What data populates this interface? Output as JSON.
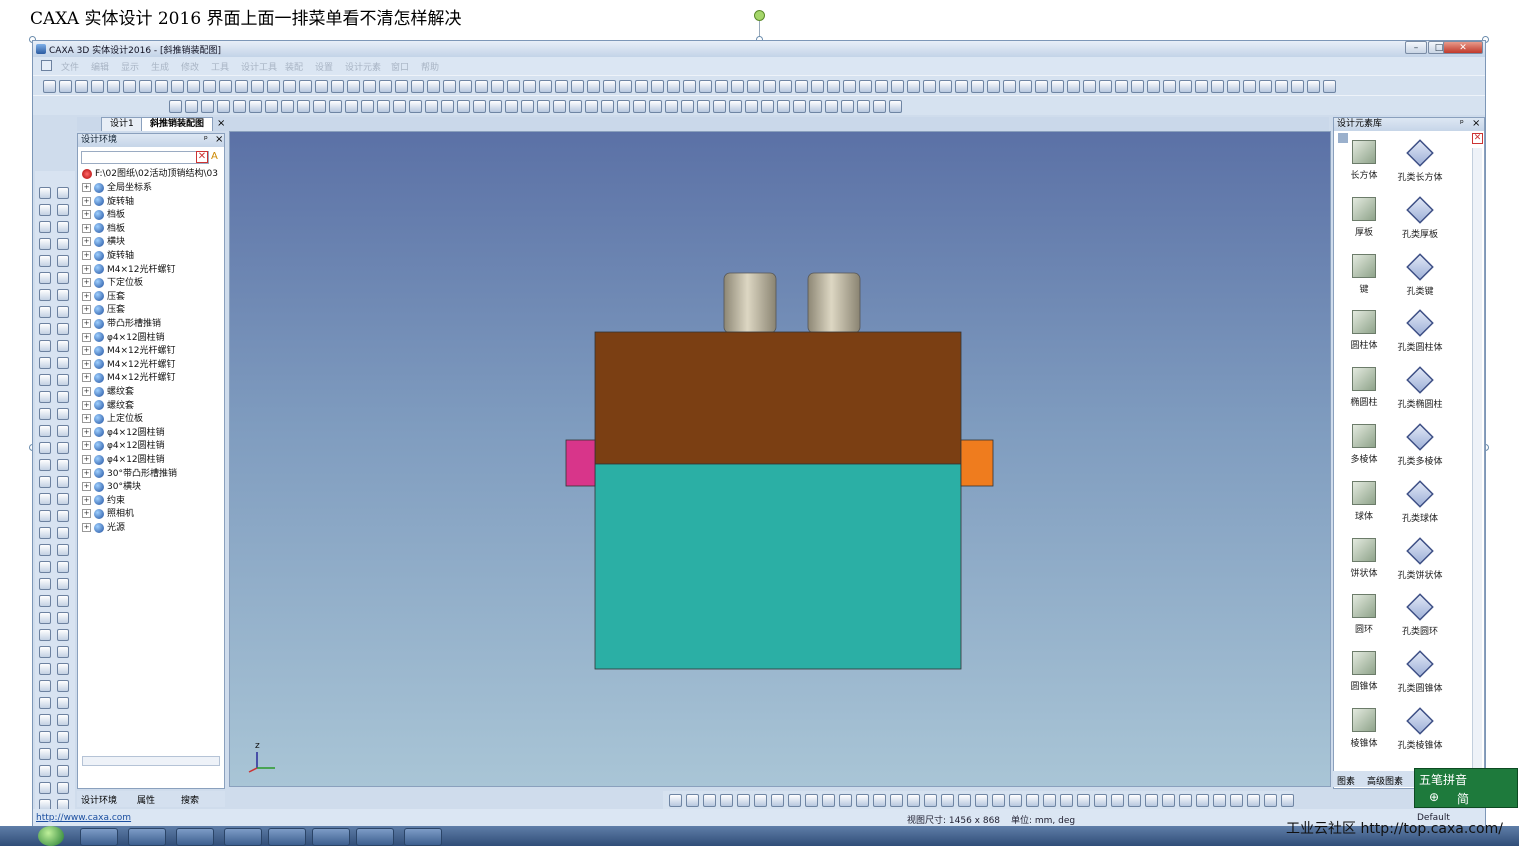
{
  "doc_caption": "CAXA 实体设计 2016 界面上面一排菜单看不清怎样解决",
  "window": {
    "title": "CAXA 3D 实体设计2016 - [斜推销装配图]",
    "buttons": [
      "–",
      "□",
      "✕"
    ]
  },
  "menu": [
    "文件",
    "编辑",
    "显示",
    "生成",
    "修改",
    "工具",
    "设计工具",
    "装配",
    "设置",
    "设计元素",
    "窗口",
    "帮助"
  ],
  "doc_tabs": [
    "设计1",
    "斜推销装配图"
  ],
  "tree_panel": {
    "title": "设计环境",
    "root": "F:\\02图纸\\02活动顶销结构\\03",
    "items": [
      "全局坐标系",
      "旋转轴",
      "档板",
      "档板",
      "横块",
      "旋转轴",
      "M4×12光杆螺钉",
      "下定位板",
      "压套",
      "压套",
      "带凸形槽推销",
      "φ4×12圆柱销",
      "M4×12光杆螺钉",
      "M4×12光杆螺钉",
      "M4×12光杆螺钉",
      "螺纹套",
      "螺纹套",
      "上定位板",
      "φ4×12圆柱销",
      "φ4×12圆柱销",
      "φ4×12圆柱销",
      "30°带凸形槽推销",
      "30°横块",
      "约束",
      "照相机",
      "光源"
    ],
    "bottom_tabs": [
      "设计环境",
      "属性",
      "搜索"
    ]
  },
  "axis_label": "z",
  "right_panel": {
    "title": "设计元素库",
    "elements": [
      [
        "长方体",
        "孔类长方体"
      ],
      [
        "厚板",
        "孔类厚板"
      ],
      [
        "键",
        "孔类键"
      ],
      [
        "圆柱体",
        "孔类圆柱体"
      ],
      [
        "椭圆柱",
        "孔类椭圆柱"
      ],
      [
        "多棱体",
        "孔类多棱体"
      ],
      [
        "球体",
        "孔类球体"
      ],
      [
        "饼状体",
        "孔类饼状体"
      ],
      [
        "圆环",
        "孔类圆环"
      ],
      [
        "圆锥体",
        "孔类圆锥体"
      ],
      [
        "棱锥体",
        "孔类棱锥体"
      ]
    ],
    "bottom_tabs": [
      "图素",
      "高级图素"
    ]
  },
  "status": {
    "url": "http://www.caxa.com",
    "view_size": "视图尺寸: 1456 x 868",
    "units": "单位: mm, deg",
    "default": "Default"
  },
  "ime": {
    "line1": "五笔拼音",
    "line2": "简",
    "line3": "⊕"
  },
  "watermark": "工业云社区 http://top.caxa.com/",
  "colors": {
    "top_block": "#7b3f13",
    "bottom_block": "#2bafa5",
    "left_pin": "#d8358a",
    "right_pin": "#ef7c1e",
    "cylinders": "#c9c2ad",
    "viewport_top": "#5b71a6",
    "viewport_bottom": "#a9c5d6"
  }
}
